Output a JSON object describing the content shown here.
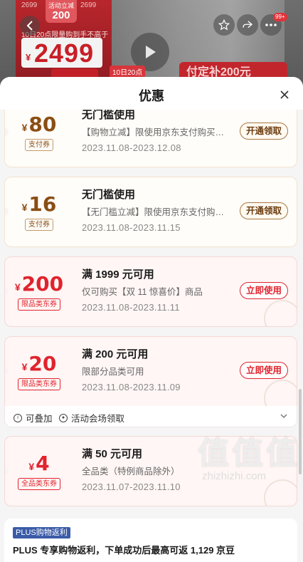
{
  "banner": {
    "tag_left": "2699",
    "tag_right": "2699",
    "tag_activity_label": "活动立减",
    "tag_activity_amount": "200",
    "notice": "10日20点限量购到手不高于",
    "price_currency": "¥",
    "price": "2499",
    "date_tag": "10日20点",
    "after_tag": "付定补200元",
    "badge": "99+"
  },
  "sheet": {
    "title": "优惠"
  },
  "coupons": [
    {
      "currency": "¥",
      "amount": "80",
      "type": "支付券",
      "title": "无门槛使用",
      "desc": "【购物立减】限使用京东支付购买…",
      "date": "2023.11.08-2023.12.08",
      "button": "开通领取"
    },
    {
      "currency": "¥",
      "amount": "16",
      "type": "支付券",
      "title": "无门槛使用",
      "desc": "【无门槛立减】限使用京东支付购…",
      "date": "2023.11.08-2023.11.15",
      "button": "开通领取"
    },
    {
      "currency": "¥",
      "amount": "200",
      "type": "限品类东券",
      "title": "满 1999 元可用",
      "desc": "仅可购买【双 11 惊喜价】商品",
      "date": "2023.11.08-2023.11.11",
      "button": "立即使用"
    },
    {
      "currency": "¥",
      "amount": "20",
      "type": "限品类东券",
      "title": "满 200 元可用",
      "desc": "限部分品类可用",
      "date": "2023.11.08-2023.11.09",
      "button": "立即使用"
    },
    {
      "currency": "¥",
      "amount": "4",
      "type": "全品类东券",
      "title": "满 50 元可用",
      "desc": "全品类（特例商品除外）",
      "date": "2023.11.07-2023.11.10"
    }
  ],
  "extra": {
    "stackable": "可叠加",
    "venue": "活动会场领取"
  },
  "plus": {
    "tag": "PLUS购物返利",
    "text": "PLUS 专享购物返利，下单成功后最高可返 1,129 京豆"
  },
  "watermark": {
    "big": "值值值",
    "small": "zhizhizhi.com"
  },
  "colors": {
    "pay_coupon_text": "#8a4e14",
    "category_coupon_red": "#e0232d",
    "plus_tag_blue": "#3b5ba8"
  }
}
